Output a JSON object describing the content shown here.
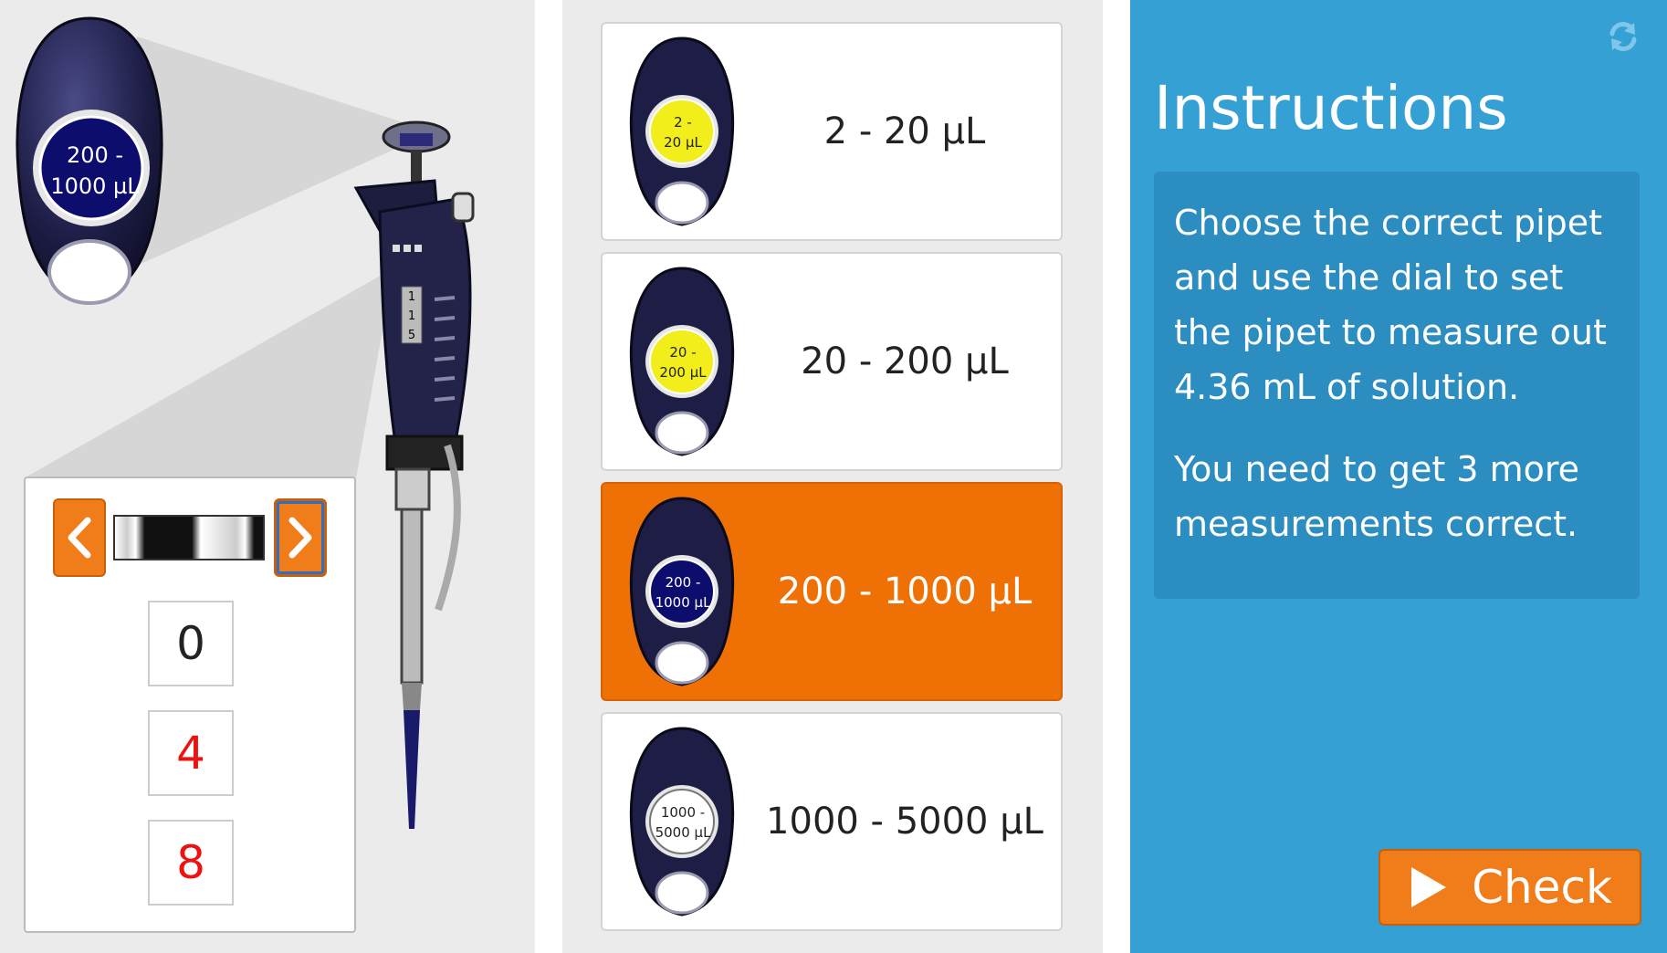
{
  "colors": {
    "accent_orange": "#f07d1a",
    "selected_orange": "#ef7105",
    "panel_blue": "#34a0d4",
    "instructions_box_blue": "#2c8dc0",
    "badge_navy": "#0d0d6e",
    "badge_yellow": "#f2ee1c",
    "badge_white": "#ffffff",
    "digit_black": "#222222",
    "digit_red": "#ee1111"
  },
  "zoom_badge": {
    "label_line1": "200 -",
    "label_line2": "1000 µL",
    "color": "#0d0d6e",
    "text_color": "#ffffff"
  },
  "pipette_volume_digits": [
    "1",
    "1",
    "5"
  ],
  "dial": {
    "prev_icon": "chevron-left-icon",
    "next_icon": "chevron-right-icon",
    "digits": [
      {
        "value": "0",
        "color": "#222222"
      },
      {
        "value": "4",
        "color": "#ee1111"
      },
      {
        "value": "8",
        "color": "#ee1111"
      }
    ]
  },
  "choices": [
    {
      "label": "2 - 20 µL",
      "badge_line1": "2 -",
      "badge_line2": "20 µL",
      "badge_color": "#f2ee1c",
      "badge_text_color": "#222222",
      "selected": false
    },
    {
      "label": "20 - 200 µL",
      "badge_line1": "20 -",
      "badge_line2": "200 µL",
      "badge_color": "#f2ee1c",
      "badge_text_color": "#222222",
      "selected": false
    },
    {
      "label": "200 - 1000 µL",
      "badge_line1": "200 -",
      "badge_line2": "1000 µL",
      "badge_color": "#0d0d6e",
      "badge_text_color": "#ffffff",
      "selected": true
    },
    {
      "label": "1000 - 5000 µL",
      "badge_line1": "1000 -",
      "badge_line2": "5000 µL",
      "badge_color": "#ffffff",
      "badge_text_color": "#222222",
      "selected": false
    }
  ],
  "instructions": {
    "title": "Instructions",
    "paragraph1": "Choose the correct pipet and use the dial to set the pipet to measure out 4.36 mL of solution.",
    "paragraph2": "You need to get 3 more measurements correct.",
    "refresh_icon": "refresh-icon"
  },
  "check_button": {
    "label": "Check",
    "icon": "play-icon"
  }
}
